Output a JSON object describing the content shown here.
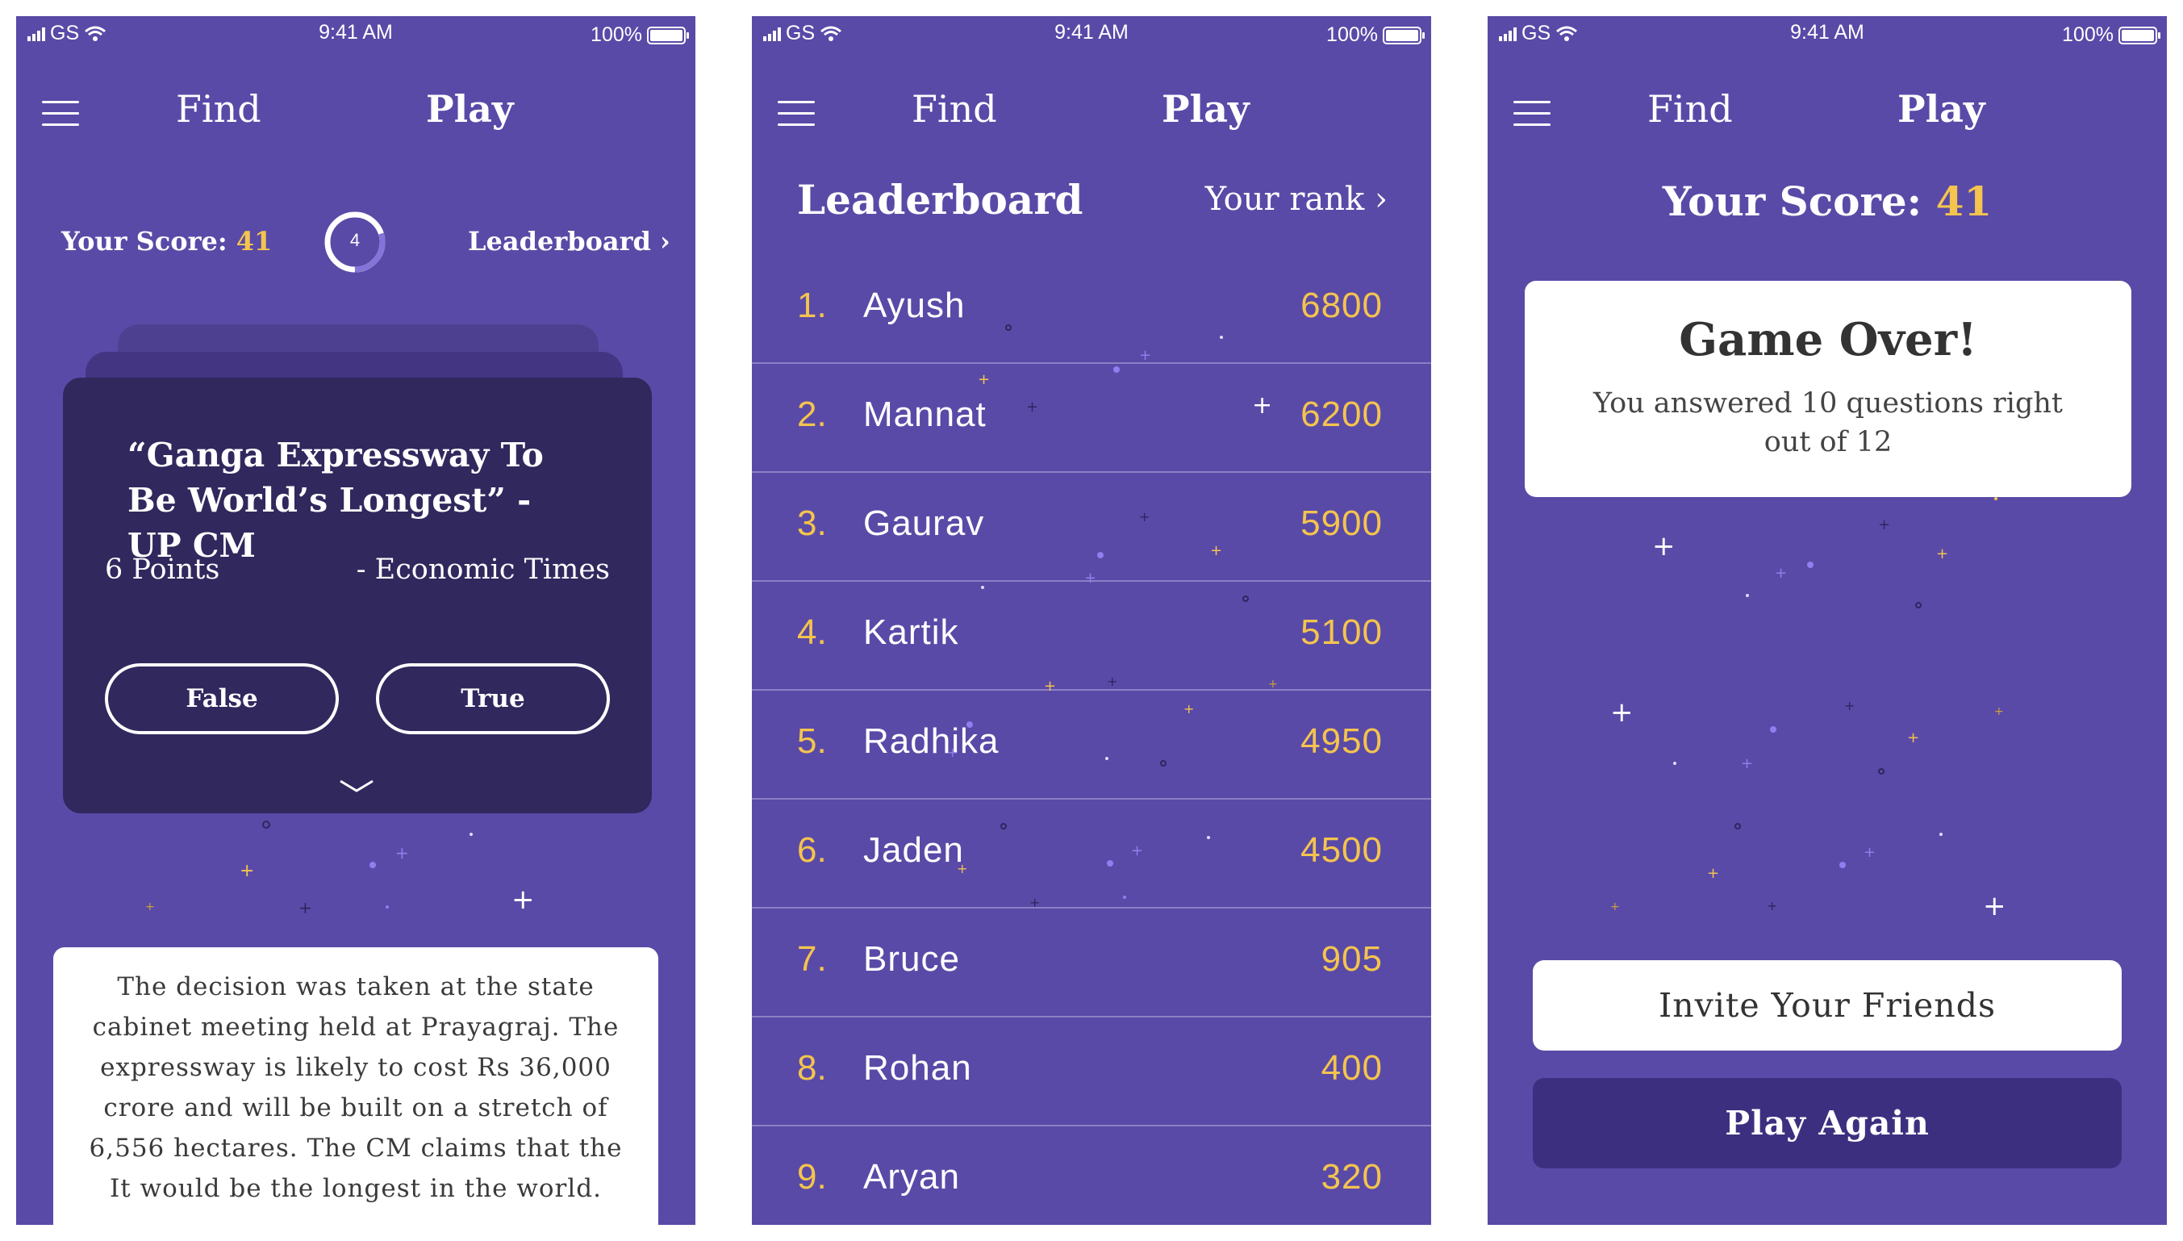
{
  "status_bar": {
    "carrier": "GS",
    "time": "9:41 AM",
    "battery": "100%"
  },
  "nav": {
    "find": "Find",
    "play": "Play"
  },
  "colors": {
    "background": "#5a4aa7",
    "card": "#31285e",
    "accent": "#f4c44e",
    "button_dark": "#3d2f80"
  },
  "question_screen": {
    "score_label": "Your Score:",
    "score_value": "41",
    "timer_value": "4",
    "timer_progress": 0.3,
    "leaderboard_link": "Leaderboard",
    "chevron": "›",
    "headline": "“Ganga Expressway To Be World’s Longest” - UP CM",
    "points": "6 Points",
    "source": "- Economic Times",
    "false_label": "False",
    "true_label": "True",
    "description": "The decision was taken at the state cabinet meeting held at Prayagraj. The expressway is likely to cost Rs 36,000 crore and will be built on a stretch of 6,556 hectares. The CM claims that the It would be the longest in the world."
  },
  "leaderboard_screen": {
    "title": "Leaderboard",
    "your_rank": "Your rank",
    "chevron": "›",
    "rows": [
      {
        "rank": "1.",
        "name": "Ayush",
        "score": "6800"
      },
      {
        "rank": "2.",
        "name": "Mannat",
        "score": "6200"
      },
      {
        "rank": "3.",
        "name": "Gaurav",
        "score": "5900"
      },
      {
        "rank": "4.",
        "name": "Kartik",
        "score": "5100"
      },
      {
        "rank": "5.",
        "name": "Radhika",
        "score": "4950"
      },
      {
        "rank": "6.",
        "name": "Jaden",
        "score": "4500"
      },
      {
        "rank": "7.",
        "name": "Bruce",
        "score": "905"
      },
      {
        "rank": "8.",
        "name": "Rohan",
        "score": "400"
      },
      {
        "rank": "9.",
        "name": "Aryan",
        "score": "320"
      }
    ]
  },
  "game_over_screen": {
    "score_label": "Your Score:",
    "score_value": "41",
    "title": "Game Over!",
    "message": "You answered 10 questions right out of 12",
    "invite_label": "Invite Your Friends",
    "play_again_label": "Play Again"
  }
}
